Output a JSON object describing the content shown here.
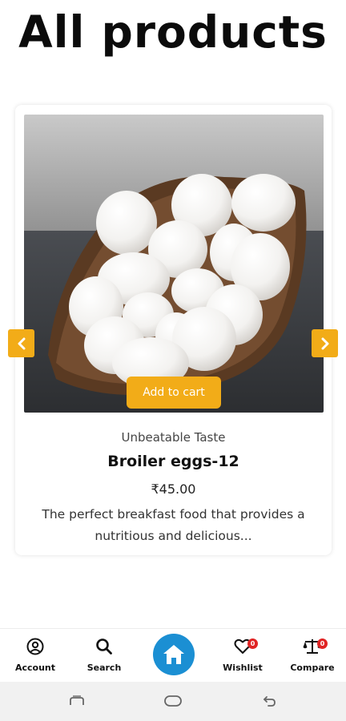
{
  "page": {
    "title": "All products"
  },
  "product": {
    "tagline": "Unbeatable Taste",
    "name": "Broiler eggs-12",
    "price": "₹45.00",
    "description": "The perfect breakfast food that provides a nutritious and delicious...",
    "image_icon": "eggs-in-basket-image",
    "add_to_cart_label": "Add to cart"
  },
  "carousel": {
    "prev_icon": "chevron-left-icon",
    "next_icon": "chevron-right-icon"
  },
  "bottom_nav": {
    "account_label": "Account",
    "search_label": "Search",
    "wishlist_label": "Wishlist",
    "wishlist_count": "0",
    "compare_label": "Compare",
    "compare_count": "0",
    "home_icon": "home-icon"
  },
  "colors": {
    "accent": "#f2ac18",
    "home_button": "#1b8fd3",
    "badge": "#e02424"
  }
}
